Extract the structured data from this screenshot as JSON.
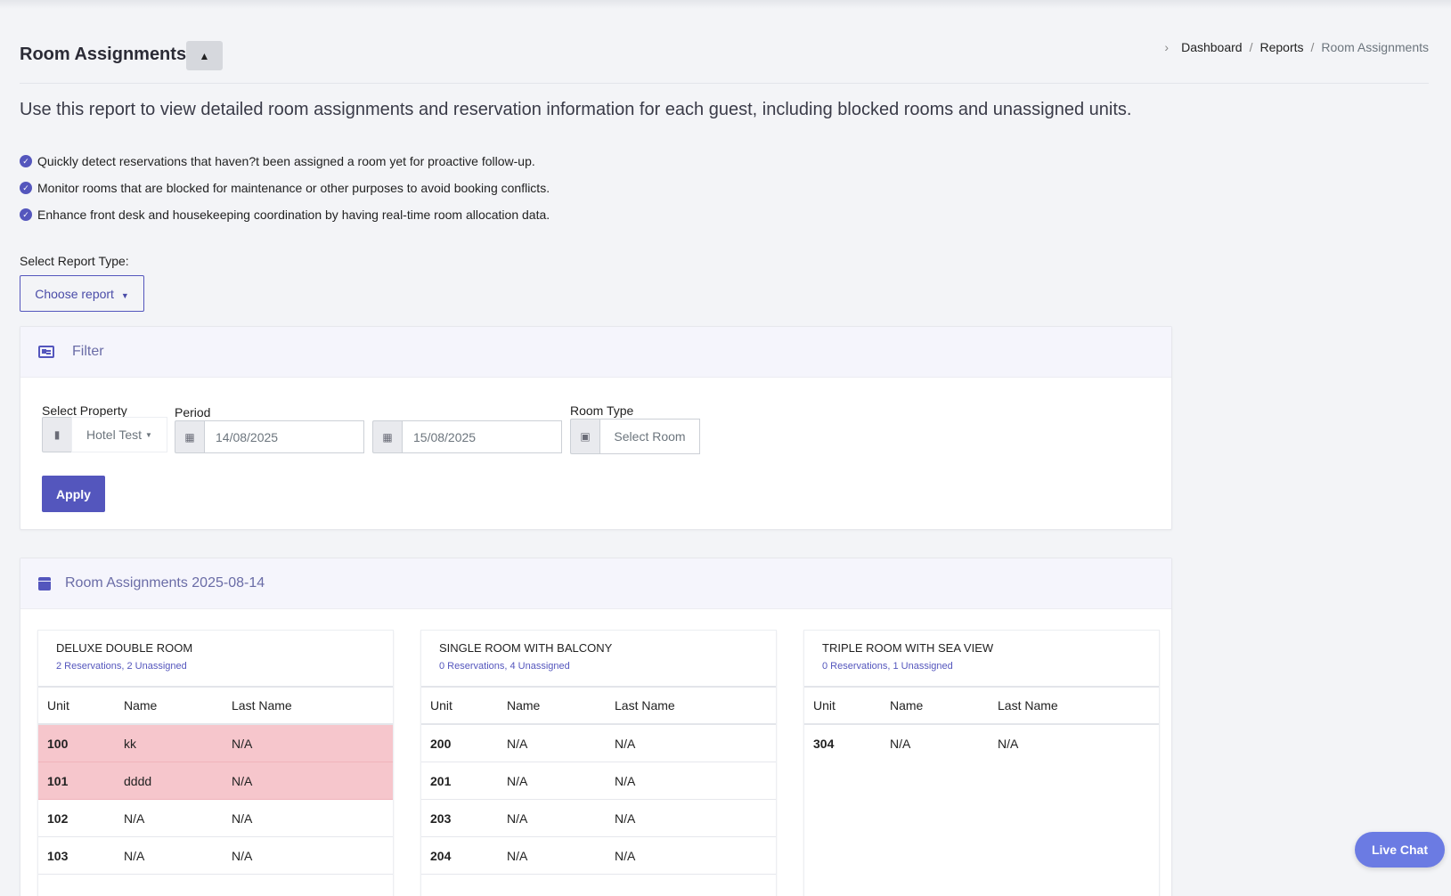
{
  "header": {
    "title": "Room Assignments",
    "collapse_symbol": "▲"
  },
  "breadcrumb": {
    "items": [
      "Dashboard",
      "Reports",
      "Room Assignments"
    ],
    "separator": "/"
  },
  "intro": "Use this report to view detailed room assignments and reservation information for each guest, including blocked rooms and unassigned units.",
  "bullets": [
    "Quickly detect reservations that haven?t been assigned a room yet for proactive follow-up.",
    "Monitor rooms that are blocked for maintenance or other purposes to avoid booking conflicts.",
    "Enhance front desk and housekeeping coordination by having real-time room allocation data."
  ],
  "report_type": {
    "label": "Select Report Type:",
    "button": "Choose report"
  },
  "filter": {
    "title": "Filter",
    "property_label": "Select Property",
    "property_value": "Hotel Test",
    "period_label": "Period",
    "period_start": "14/08/2025",
    "period_end": "15/08/2025",
    "room_type_label": "Room Type",
    "room_type_value": "Select Room",
    "apply": "Apply"
  },
  "assignments": {
    "title": "Room Assignments 2025-08-14",
    "columns": [
      "Unit",
      "Name",
      "Last Name"
    ],
    "rooms": [
      {
        "name": "DELUXE DOUBLE ROOM",
        "summary": "2 Reservations, 2 Unassigned",
        "rows": [
          {
            "unit": "100",
            "name": "kk",
            "last": "N/A",
            "blocked": true
          },
          {
            "unit": "101",
            "name": "dddd",
            "last": "N/A",
            "blocked": true
          },
          {
            "unit": "102",
            "name": "N/A",
            "last": "N/A",
            "blocked": false
          },
          {
            "unit": "103",
            "name": "N/A",
            "last": "N/A",
            "blocked": false
          }
        ]
      },
      {
        "name": "SINGLE ROOM WITH BALCONY",
        "summary": "0 Reservations, 4 Unassigned",
        "rows": [
          {
            "unit": "200",
            "name": "N/A",
            "last": "N/A",
            "blocked": false
          },
          {
            "unit": "201",
            "name": "N/A",
            "last": "N/A",
            "blocked": false
          },
          {
            "unit": "203",
            "name": "N/A",
            "last": "N/A",
            "blocked": false
          },
          {
            "unit": "204",
            "name": "N/A",
            "last": "N/A",
            "blocked": false
          }
        ]
      },
      {
        "name": "TRIPLE ROOM WITH SEA VIEW",
        "summary": "0 Reservations, 1 Unassigned",
        "rows": [
          {
            "unit": "304",
            "name": "N/A",
            "last": "N/A",
            "blocked": false
          }
        ]
      }
    ]
  },
  "live_chat": "Live Chat",
  "colors": {
    "accent": "#5456bd",
    "blocked_row": "#f6c6cc",
    "live_chat": "#6b7be3"
  }
}
